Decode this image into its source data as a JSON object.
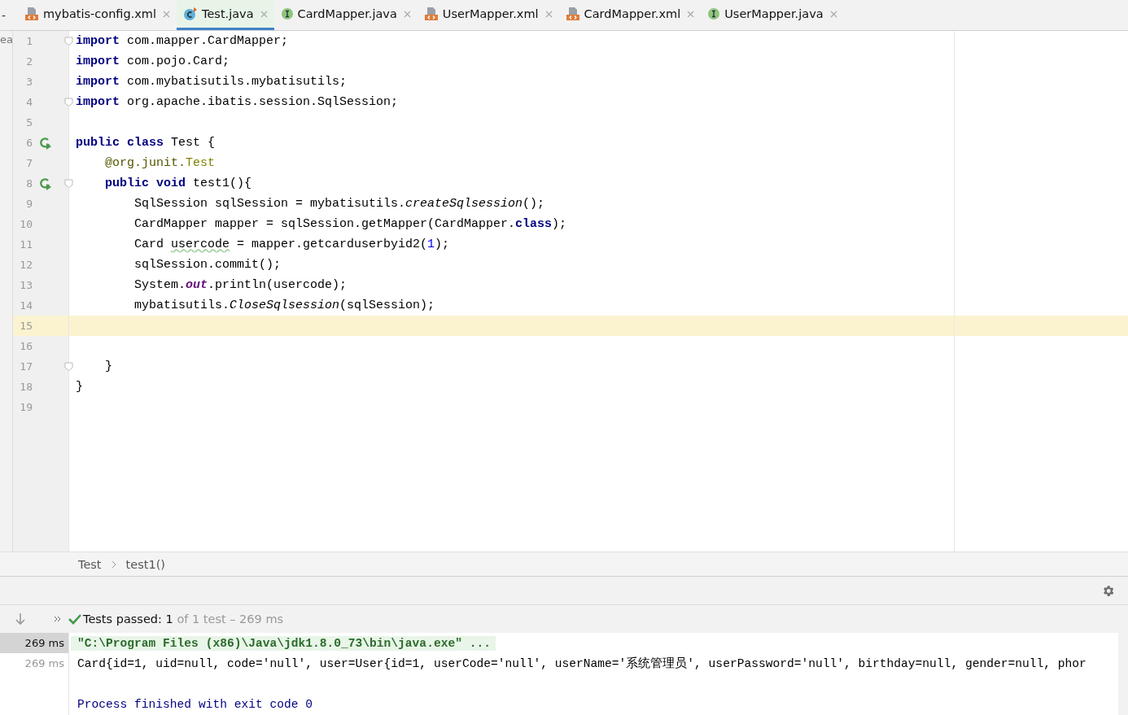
{
  "edge_texts": {
    "top": "-",
    "side": "ea"
  },
  "tabs": [
    {
      "label": "mybatis-config.xml",
      "kind": "xml",
      "selected": false
    },
    {
      "label": "Test.java",
      "kind": "class",
      "selected": true
    },
    {
      "label": "CardMapper.java",
      "kind": "interface",
      "selected": false
    },
    {
      "label": "UserMapper.xml",
      "kind": "xml",
      "selected": false
    },
    {
      "label": "CardMapper.xml",
      "kind": "xml",
      "selected": false
    },
    {
      "label": "UserMapper.java",
      "kind": "interface",
      "selected": false
    }
  ],
  "editor": {
    "lines": [
      {
        "number": "1",
        "current": false,
        "run": false,
        "fold": true,
        "tokens": [
          {
            "kind": "kw",
            "text": "import"
          },
          {
            "kind": "plain",
            "text": " com.mapper.CardMapper;"
          }
        ]
      },
      {
        "number": "2",
        "current": false,
        "run": false,
        "fold": false,
        "tokens": [
          {
            "kind": "kw",
            "text": "import"
          },
          {
            "kind": "plain",
            "text": " com.pojo.Card;"
          }
        ]
      },
      {
        "number": "3",
        "current": false,
        "run": false,
        "fold": false,
        "tokens": [
          {
            "kind": "kw",
            "text": "import"
          },
          {
            "kind": "plain",
            "text": " com.mybatisutils.mybatisutils;"
          }
        ]
      },
      {
        "number": "4",
        "current": false,
        "run": false,
        "fold": true,
        "tokens": [
          {
            "kind": "kw",
            "text": "import"
          },
          {
            "kind": "plain",
            "text": " org.apache.ibatis.session.SqlSession;"
          }
        ]
      },
      {
        "number": "5",
        "current": false,
        "run": false,
        "fold": false
      },
      {
        "number": "6",
        "current": false,
        "run": true,
        "fold": false,
        "tokens": [
          {
            "kind": "kw",
            "text": "public class"
          },
          {
            "kind": "plain",
            "text": " Test {"
          }
        ]
      },
      {
        "number": "7",
        "current": false,
        "run": false,
        "fold": false,
        "tokens": [
          {
            "kind": "annotation",
            "text": "    @org.junit."
          },
          {
            "kind": "annotation-name",
            "text": "Test"
          }
        ]
      },
      {
        "number": "8",
        "current": false,
        "run": true,
        "fold": true,
        "tokens": [
          {
            "kind": "kw",
            "text": "    public void"
          },
          {
            "kind": "plain",
            "text": " test1(){"
          }
        ]
      },
      {
        "number": "9",
        "current": false,
        "run": false,
        "fold": false,
        "tokens": [
          {
            "kind": "plain",
            "text": "        SqlSession sqlSession = mybatisutils."
          },
          {
            "kind": "italic",
            "text": "createSqlsession"
          },
          {
            "kind": "plain",
            "text": "();"
          }
        ]
      },
      {
        "number": "10",
        "current": false,
        "run": false,
        "fold": false,
        "tokens": [
          {
            "kind": "plain",
            "text": "        CardMapper mapper = sqlSession.getMapper(CardMapper."
          },
          {
            "kind": "kw",
            "text": "class"
          },
          {
            "kind": "plain",
            "text": ");"
          }
        ]
      },
      {
        "number": "11",
        "current": false,
        "run": false,
        "fold": false,
        "tokens": [
          {
            "kind": "plain",
            "text": "        Card "
          },
          {
            "kind": "warn",
            "text": "usercode"
          },
          {
            "kind": "plain",
            "text": " = mapper.getcarduserbyid2("
          },
          {
            "kind": "num",
            "text": "1"
          },
          {
            "kind": "plain",
            "text": ");"
          }
        ]
      },
      {
        "number": "12",
        "current": false,
        "run": false,
        "fold": false,
        "tokens": [
          {
            "kind": "plain",
            "text": "        sqlSession.commit();"
          }
        ]
      },
      {
        "number": "13",
        "current": false,
        "run": false,
        "fold": false,
        "tokens": [
          {
            "kind": "plain",
            "text": "        System."
          },
          {
            "kind": "static",
            "text": "out"
          },
          {
            "kind": "plain",
            "text": ".println(usercode);"
          }
        ]
      },
      {
        "number": "14",
        "current": false,
        "run": false,
        "fold": false,
        "tokens": [
          {
            "kind": "plain",
            "text": "        mybatisutils."
          },
          {
            "kind": "italic",
            "text": "CloseSqlsession"
          },
          {
            "kind": "plain",
            "text": "(sqlSession);"
          }
        ]
      },
      {
        "number": "15",
        "current": true,
        "run": false,
        "fold": false
      },
      {
        "number": "16",
        "current": false,
        "run": false,
        "fold": false
      },
      {
        "number": "17",
        "current": false,
        "run": false,
        "fold": true,
        "tokens": [
          {
            "kind": "plain",
            "text": "    }"
          }
        ]
      },
      {
        "number": "18",
        "current": false,
        "run": false,
        "fold": false,
        "tokens": [
          {
            "kind": "plain",
            "text": "}"
          }
        ]
      },
      {
        "number": "19",
        "current": false,
        "run": false,
        "fold": false
      }
    ]
  },
  "breadcrumb": [
    "Test",
    "test1()"
  ],
  "test_status": {
    "passed": true,
    "label": "Tests passed: 1",
    "detail": "of 1 test – 269 ms"
  },
  "console": {
    "times": [
      {
        "text": "269 ms",
        "selected": true
      },
      {
        "text": "269 ms",
        "selected": false
      }
    ],
    "lines": [
      {
        "kind": "command",
        "text": "\"C:\\Program Files (x86)\\Java\\jdk1.8.0_73\\bin\\java.exe\" ..."
      },
      {
        "kind": "output",
        "text": "Card{id=1, uid=null, code='null', user=User{id=1, userCode='null', userName='系统管理员', userPassword='null', birthday=null, gender=null, phor"
      },
      {
        "kind": "blank"
      },
      {
        "kind": "exit",
        "text": "Process finished with exit code 0"
      }
    ]
  }
}
